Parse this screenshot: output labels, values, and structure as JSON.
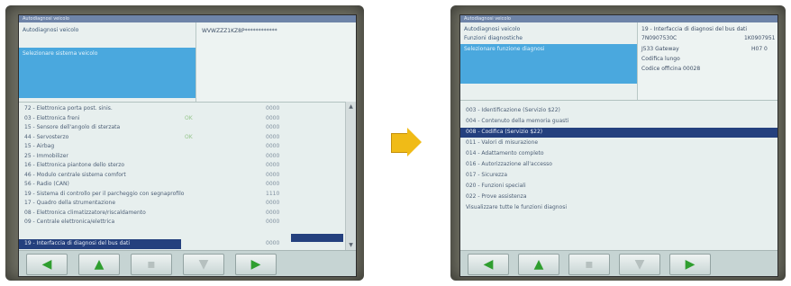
{
  "left": {
    "title": "Autodiagnosi veicolo",
    "header_item": "Autodiagnosi veicolo",
    "header_right": "WVWZZZ1KZ8P************",
    "header_selected": "Selezionare sistema veicolo",
    "rows": [
      {
        "name": "72 - Elettronica porta post. sinis.",
        "code": "",
        "value": "0000"
      },
      {
        "name": "03 - Elettronica freni",
        "code": "OK",
        "value": "0000"
      },
      {
        "name": "15 - Sensore dell'angolo di sterzata",
        "code": "",
        "value": "0000"
      },
      {
        "name": "44 - Servosterzo",
        "code": "OK",
        "value": "0000"
      },
      {
        "name": "15 - Airbag",
        "code": "",
        "value": "0000"
      },
      {
        "name": "25 - Immobilizer",
        "code": "",
        "value": "0000"
      },
      {
        "name": "16 - Elettronica piantone dello sterzo",
        "code": "",
        "value": "0000"
      },
      {
        "name": "46 - Modulo centrale sistema comfort",
        "code": "",
        "value": "0000"
      },
      {
        "name": "56 - Radio (CAN)",
        "code": "",
        "value": "0000"
      },
      {
        "name": "19 - Sistema di controllo per il parcheggio con segnaprofilo",
        "code": "",
        "value": "1110"
      },
      {
        "name": "17 - Quadro della strumentazione",
        "code": "",
        "value": "0000"
      },
      {
        "name": "08 - Elettronica climatizzatore/riscaldamento",
        "code": "",
        "value": "0000"
      },
      {
        "name": "09 - Centrale elettronica/elettrica",
        "code": "",
        "value": "0000"
      },
      {
        "name": "19 - Interfaccia di diagnosi del bus dati",
        "code": "",
        "value": "0000"
      }
    ]
  },
  "right": {
    "title": "Autodiagnosi veicolo",
    "header_items": [
      "Autodiagnosi veicolo",
      "Funzioni diagnostiche"
    ],
    "header_selected": "Selezionare funzione diagnosi",
    "info": [
      "19 - Interfaccia di diagnosi del bus dati",
      "7N0907530C",
      "J533 Gateway",
      "Codifica lungo",
      "Codice officina 00028"
    ],
    "info_side": [
      "1K0907951",
      "H07 0"
    ],
    "rows": [
      "003 - Identificazione (Servizio $22)",
      "004 - Contenuto della memoria guasti",
      "008 - Codifica (Servizio $22)",
      "011 - Valori di misurazione",
      "014 - Adattamento completo",
      "016 - Autorizzazione all'accesso",
      "017 - Sicurezza",
      "020 - Funzioni speciali",
      "022 - Prove assistenza",
      "Visualizzare tutte le funzioni diagnosi"
    ]
  },
  "toolbar": {
    "back_icon": "◀",
    "up_icon": "▲",
    "print_icon": "▪",
    "down_icon": "▼",
    "forward_icon": "▶"
  },
  "colors": {
    "selection": "#24407e",
    "header_highlight": "#4aa8de",
    "nav_arrow": "#2f9e2f",
    "transition_arrow": "#f0bb17"
  }
}
